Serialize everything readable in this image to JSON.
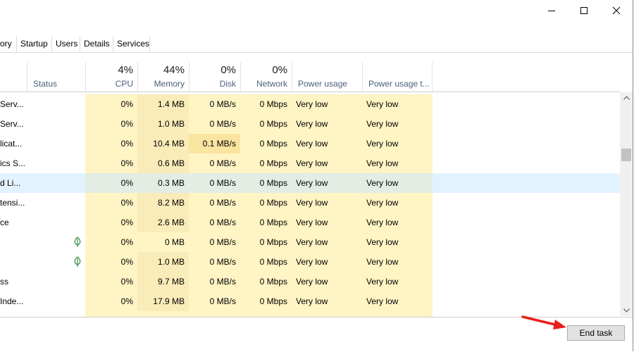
{
  "window": {
    "controls": {
      "minimize": "minimize-icon",
      "maximize": "maximize-icon",
      "close": "close-icon"
    }
  },
  "tabs": [
    {
      "label": "ory"
    },
    {
      "label": "Startup"
    },
    {
      "label": "Users"
    },
    {
      "label": "Details"
    },
    {
      "label": "Services"
    }
  ],
  "columns": {
    "status": {
      "label": "Status"
    },
    "cpu": {
      "percent": "4%",
      "label": "CPU"
    },
    "memory": {
      "percent": "44%",
      "label": "Memory"
    },
    "disk": {
      "percent": "0%",
      "label": "Disk"
    },
    "network": {
      "percent": "0%",
      "label": "Network"
    },
    "power": {
      "label": "Power usage"
    },
    "power_trend": {
      "label": "Power usage t..."
    }
  },
  "rows": [
    {
      "name": "Serv...",
      "status_icon": "",
      "cpu": "0%",
      "memory": "1.4 MB",
      "disk": "0 MB/s",
      "network": "0 Mbps",
      "power": "Very low",
      "power_trend": "Very low"
    },
    {
      "name": "Serv...",
      "status_icon": "",
      "cpu": "0%",
      "memory": "1.0 MB",
      "disk": "0 MB/s",
      "network": "0 Mbps",
      "power": "Very low",
      "power_trend": "Very low"
    },
    {
      "name": "licat...",
      "status_icon": "",
      "cpu": "0%",
      "memory": "10.4 MB",
      "disk": "0.1 MB/s",
      "network": "0 Mbps",
      "power": "Very low",
      "power_trend": "Very low"
    },
    {
      "name": "ics S...",
      "status_icon": "",
      "cpu": "0%",
      "memory": "0.6 MB",
      "disk": "0 MB/s",
      "network": "0 Mbps",
      "power": "Very low",
      "power_trend": "Very low"
    },
    {
      "name": "d Li...",
      "status_icon": "",
      "cpu": "0%",
      "memory": "0.3 MB",
      "disk": "0 MB/s",
      "network": "0 Mbps",
      "power": "Very low",
      "power_trend": "Very low",
      "selected": true
    },
    {
      "name": "tensi...",
      "status_icon": "",
      "cpu": "0%",
      "memory": "8.2 MB",
      "disk": "0 MB/s",
      "network": "0 Mbps",
      "power": "Very low",
      "power_trend": "Very low"
    },
    {
      "name": "ce",
      "status_icon": "",
      "cpu": "0%",
      "memory": "2.6 MB",
      "disk": "0 MB/s",
      "network": "0 Mbps",
      "power": "Very low",
      "power_trend": "Very low"
    },
    {
      "name": "",
      "status_icon": "leaf-icon",
      "cpu": "0%",
      "memory": "0 MB",
      "disk": "0 MB/s",
      "network": "0 Mbps",
      "power": "Very low",
      "power_trend": "Very low"
    },
    {
      "name": "",
      "status_icon": "leaf-icon",
      "cpu": "0%",
      "memory": "1.0 MB",
      "disk": "0 MB/s",
      "network": "0 Mbps",
      "power": "Very low",
      "power_trend": "Very low"
    },
    {
      "name": "ss",
      "status_icon": "",
      "cpu": "0%",
      "memory": "9.7 MB",
      "disk": "0 MB/s",
      "network": "0 Mbps",
      "power": "Very low",
      "power_trend": "Very low"
    },
    {
      "name": "Inde...",
      "status_icon": "",
      "cpu": "0%",
      "memory": "17.9 MB",
      "disk": "0 MB/s",
      "network": "0 Mbps",
      "power": "Very low",
      "power_trend": "Very low"
    }
  ],
  "footer": {
    "end_task_label": "End task"
  },
  "colors": {
    "heat_light": "#fff4c4",
    "heat_medium": "#f9ecb8",
    "heat_strong": "#f9e4a0",
    "selection": "#cce8ff",
    "arrow": "#e8201a",
    "leaf": "#2e8b3e"
  }
}
